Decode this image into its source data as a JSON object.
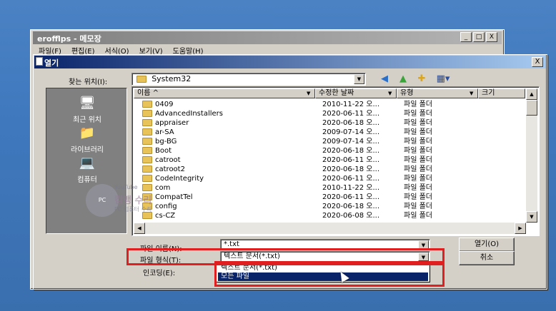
{
  "notepad": {
    "title": "erofflps - 메모장",
    "menu": [
      "파일(F)",
      "편집(E)",
      "서식(O)",
      "보기(V)",
      "도움말(H)"
    ],
    "buttons": [
      "_",
      "□",
      "X"
    ]
  },
  "dialog": {
    "title": "열기",
    "close": "X",
    "look_in_label": "찾는 위치(I):",
    "look_in_value": "System32",
    "places": [
      {
        "label": "최근 위치",
        "icon": "recent-places-icon"
      },
      {
        "label": "라이브러리",
        "icon": "libraries-icon"
      },
      {
        "label": "컴퓨터",
        "icon": "computer-icon"
      }
    ],
    "columns": [
      "이름",
      "수정한 날짜",
      "유형",
      "크기"
    ],
    "files": [
      {
        "name": "0409",
        "date": "2010-11-22 오...",
        "type": "파일 폴더"
      },
      {
        "name": "AdvancedInstallers",
        "date": "2020-06-11 오...",
        "type": "파일 폴더"
      },
      {
        "name": "appraiser",
        "date": "2020-06-18 오...",
        "type": "파일 폴더"
      },
      {
        "name": "ar-SA",
        "date": "2009-07-14 오...",
        "type": "파일 폴더"
      },
      {
        "name": "bg-BG",
        "date": "2009-07-14 오...",
        "type": "파일 폴더"
      },
      {
        "name": "Boot",
        "date": "2020-06-18 오...",
        "type": "파일 폴더"
      },
      {
        "name": "catroot",
        "date": "2020-06-11 오...",
        "type": "파일 폴더"
      },
      {
        "name": "catroot2",
        "date": "2020-06-18 오...",
        "type": "파일 폴더"
      },
      {
        "name": "CodeIntegrity",
        "date": "2020-06-11 오...",
        "type": "파일 폴더"
      },
      {
        "name": "com",
        "date": "2010-11-22 오...",
        "type": "파일 폴더"
      },
      {
        "name": "CompatTel",
        "date": "2020-06-11 오...",
        "type": "파일 폴더"
      },
      {
        "name": "config",
        "date": "2020-06-18 오...",
        "type": "파일 폴더"
      },
      {
        "name": "cs-CZ",
        "date": "2020-06-08 오...",
        "type": "파일 폴더"
      }
    ],
    "filename_label": "파일 이름(N):",
    "filename_value": "*.txt",
    "filetype_label": "파일 형식(T):",
    "filetype_value": "텍스트 문서(*.txt)",
    "encoding_label": "인코딩(E):",
    "filetype_options": [
      "텍스트 문서(*.txt)",
      "모든 파일"
    ],
    "open_button": "열기(O)",
    "cancel_button": "취소"
  },
  "watermark": {
    "badge": "PC",
    "channel": "YouTube",
    "name": "컴맹 수리",
    "sub": "PC 컴퓨터 수리"
  },
  "colors": {
    "highlight": "#0a246a",
    "annotation": "#e02020",
    "title_active": "#0a246a"
  }
}
